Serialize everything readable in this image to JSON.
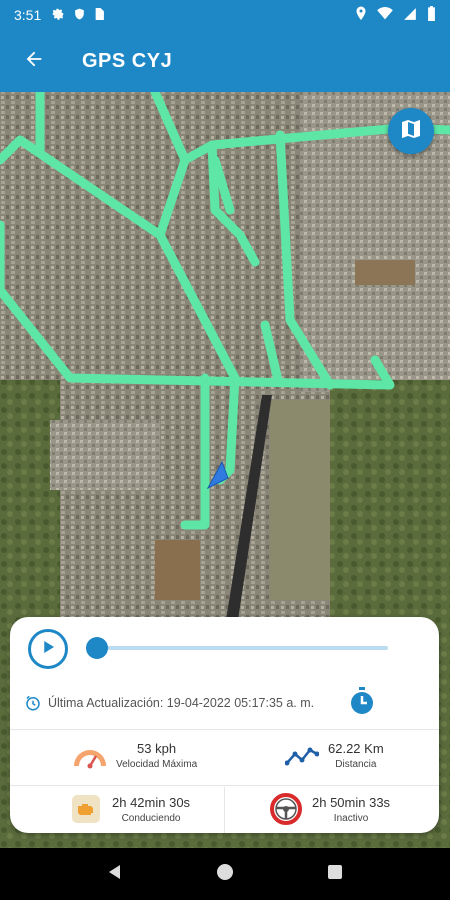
{
  "status_bar": {
    "time": "3:51",
    "left_icons": [
      "gear-icon",
      "shield-icon",
      "sim-card-icon"
    ],
    "right_icons": [
      "location-icon",
      "wifi-icon",
      "signal-icon",
      "battery-icon"
    ]
  },
  "app_bar": {
    "title": "GPS CYJ",
    "back_icon": "arrow-back-icon"
  },
  "map": {
    "layers_icon": "map-icon",
    "route_color": "#5ee6a6",
    "vehicle_marker_color": "#2f7be0"
  },
  "playback": {
    "play_icon": "play-icon",
    "progress": 0.0
  },
  "last_update": {
    "text": "Última Actualización: 19-04-2022 05:17:35 a. m."
  },
  "stats": {
    "max_speed": {
      "value": "53 kph",
      "label": "Velocidad Máxima"
    },
    "distance": {
      "value": "62.22 Km",
      "label": "Distancia"
    },
    "driving": {
      "value": "2h 42min 30s",
      "label": "Conduciendo"
    },
    "idle": {
      "value": "2h 50min 33s",
      "label": "Inactivo"
    }
  },
  "colors": {
    "primary": "#1e88c7",
    "route": "#5ee6a6"
  }
}
